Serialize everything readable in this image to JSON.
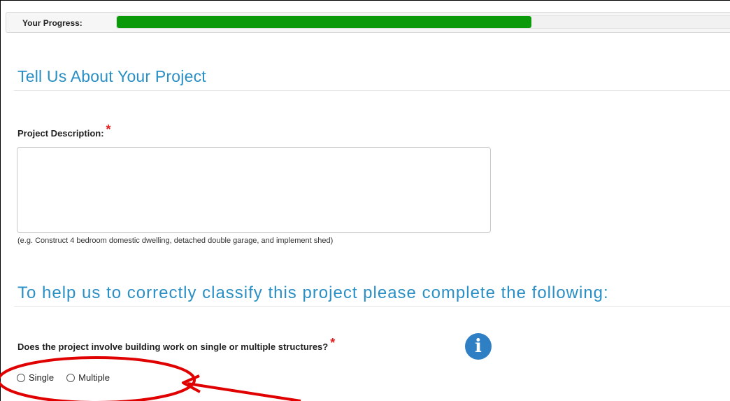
{
  "progress": {
    "label": "Your Progress:",
    "fraction": 0.675,
    "fill_color": "#0a9a0a"
  },
  "section1": {
    "title": "Tell Us About Your Project"
  },
  "description": {
    "label": "Project Description:",
    "required_mark": "*",
    "value": "",
    "hint": "(e.g. Construct 4 bedroom domestic dwelling, detached double garage, and implement shed)"
  },
  "section2": {
    "title": "To help us to correctly classify this project please complete the following:"
  },
  "structures": {
    "question": "Does the project involve building work on single or multiple structures?",
    "required_mark": "*",
    "info_icon": "info-icon",
    "info_glyph": "i",
    "options": [
      {
        "label": "Single",
        "selected": false
      },
      {
        "label": "Multiple",
        "selected": false
      }
    ]
  },
  "annotation": {
    "color": "#e00000",
    "shape": "ellipse-with-arrow"
  }
}
